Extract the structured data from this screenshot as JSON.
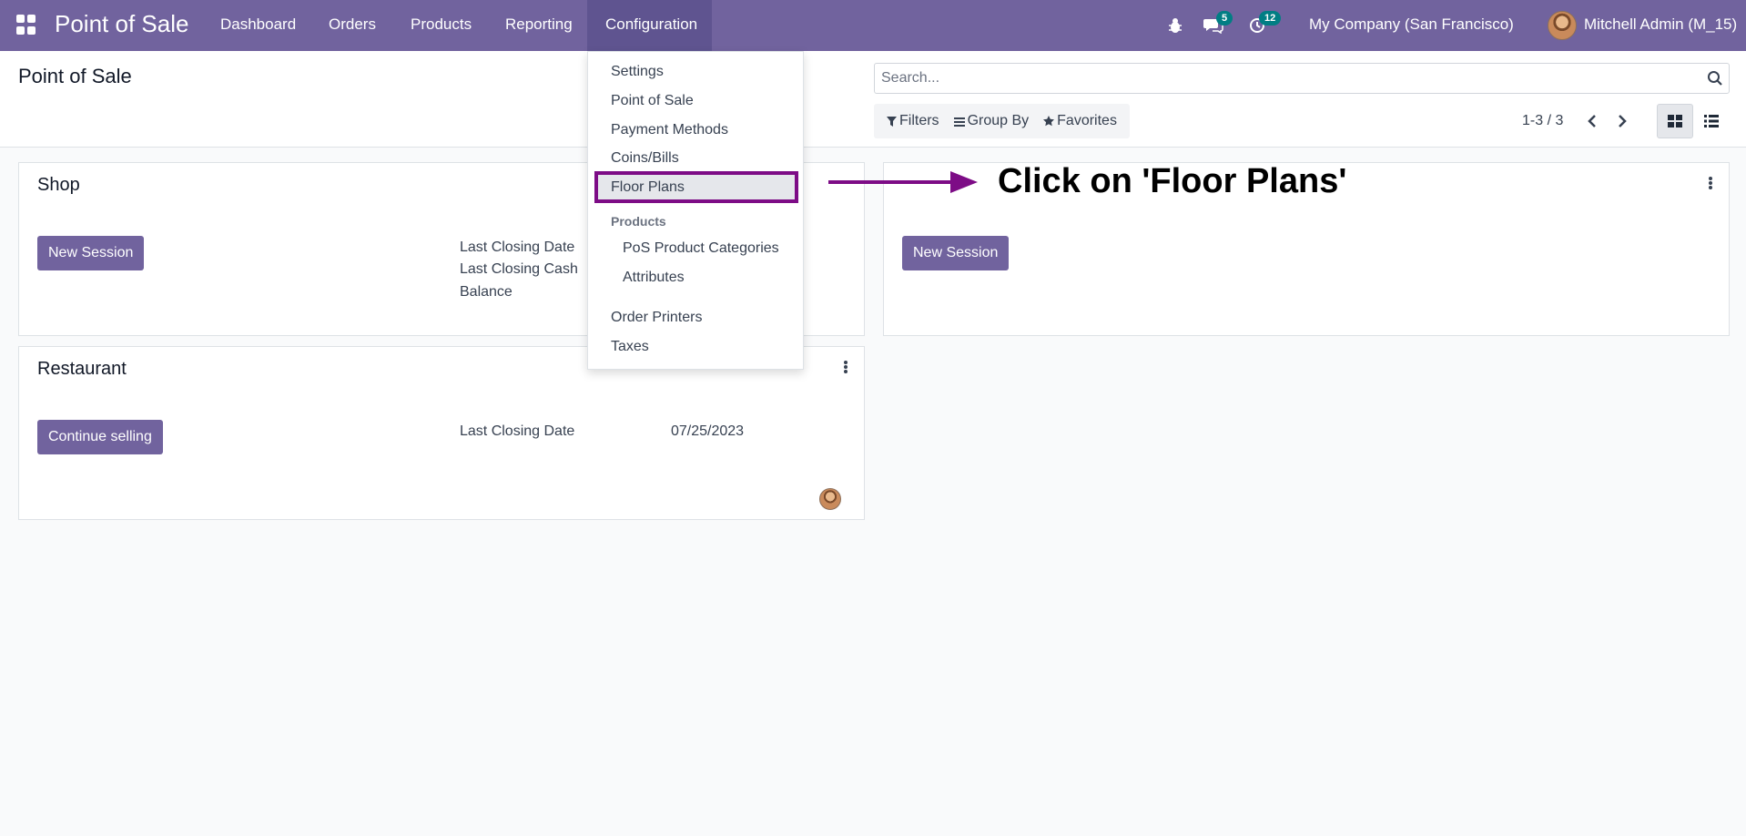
{
  "navbar": {
    "brand": "Point of Sale",
    "menu": [
      "Dashboard",
      "Orders",
      "Products",
      "Reporting",
      "Configuration"
    ],
    "messages_count": "5",
    "activities_count": "12",
    "company": "My Company (San Francisco)",
    "user": "Mitchell Admin (M_15)"
  },
  "control_panel": {
    "title": "Point of Sale",
    "search_placeholder": "Search...",
    "filters_label": "Filters",
    "group_by_label": "Group By",
    "favorites_label": "Favorites",
    "pager": "1-3 / 3"
  },
  "cards": {
    "shop": {
      "title": "Shop",
      "button": "New Session",
      "labels": [
        "Last Closing Date",
        "Last Closing Cash",
        "Balance"
      ]
    },
    "right": {
      "button": "New Session"
    },
    "restaurant": {
      "title": "Restaurant",
      "button": "Continue selling",
      "label": "Last Closing Date",
      "value": "07/25/2023"
    }
  },
  "dropdown": {
    "items": [
      "Settings",
      "Point of Sale",
      "Payment Methods",
      "Coins/Bills",
      "Floor Plans"
    ],
    "products_header": "Products",
    "product_items": [
      "PoS Product Categories",
      "Attributes"
    ],
    "bottom_items": [
      "Order Printers",
      "Taxes"
    ]
  },
  "annotation": "Click on 'Floor Plans'",
  "colors": {
    "brand": "#71639e",
    "active_nav": "#5f5490",
    "badge": "#017e84",
    "highlight_border": "#7d0c86"
  }
}
